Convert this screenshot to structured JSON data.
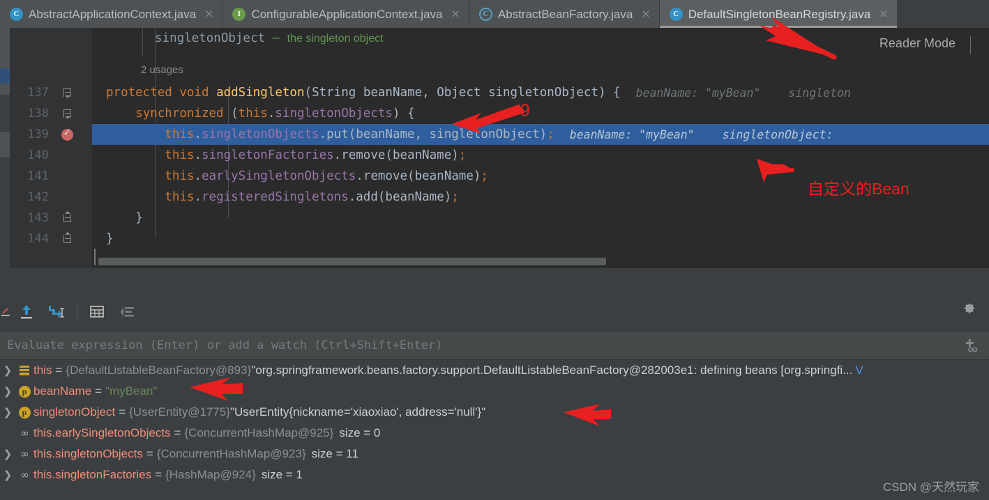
{
  "tabs": [
    {
      "label": "AbstractApplicationContext.java",
      "icon": "java-class-icon",
      "icon_kind": "cls",
      "active": false,
      "close": "×"
    },
    {
      "label": "ConfigurableApplicationContext.java",
      "icon": "java-interface-icon",
      "icon_kind": "iface",
      "active": false,
      "close": "×"
    },
    {
      "label": "AbstractBeanFactory.java",
      "icon": "java-class-icon",
      "icon_kind": "cls-ring",
      "active": false,
      "close": "×"
    },
    {
      "label": "DefaultSingletonBeanRegistry.java",
      "icon": "java-class-icon",
      "icon_kind": "cls",
      "active": true,
      "close": "×"
    }
  ],
  "editor": {
    "reader_mode_label": "Reader Mode",
    "usages_label": "2 usages",
    "javadoc": {
      "param": "singletonObject",
      "dash": " – ",
      "text": "the singleton object"
    },
    "lines": [
      {
        "number": "137",
        "fold": "arrow",
        "breakpoint": false,
        "highlight": false,
        "tokens": [
          {
            "t": "protected",
            "c": "kw"
          },
          {
            "t": " ",
            "c": "plain"
          },
          {
            "t": "void",
            "c": "kw"
          },
          {
            "t": " ",
            "c": "plain"
          },
          {
            "t": "addSingleton",
            "c": "mth"
          },
          {
            "t": "(",
            "c": "punc"
          },
          {
            "t": "String",
            "c": "typ"
          },
          {
            "t": " beanName, ",
            "c": "plain"
          },
          {
            "t": "Object",
            "c": "typ"
          },
          {
            "t": " singletonObject",
            "c": "plain"
          },
          {
            "t": ") {",
            "c": "punc"
          }
        ],
        "hints": [
          {
            "label": "beanName:",
            "value": "\"myBean\""
          },
          {
            "label": "singleton",
            "value": ""
          }
        ]
      },
      {
        "number": "138",
        "fold": "arrow",
        "breakpoint": false,
        "highlight": false,
        "tokens": [
          {
            "t": "    ",
            "c": "plain"
          },
          {
            "t": "synchronized",
            "c": "kw"
          },
          {
            "t": " (",
            "c": "punc"
          },
          {
            "t": "this",
            "c": "kw"
          },
          {
            "t": ".",
            "c": "punc"
          },
          {
            "t": "singletonObjects",
            "c": "fld"
          },
          {
            "t": ") {",
            "c": "punc"
          }
        ],
        "hints": []
      },
      {
        "number": "139",
        "fold": "none",
        "breakpoint": true,
        "highlight": true,
        "tokens": [
          {
            "t": "        ",
            "c": "plain"
          },
          {
            "t": "this",
            "c": "kw"
          },
          {
            "t": ".",
            "c": "punc"
          },
          {
            "t": "singletonObjects",
            "c": "fld"
          },
          {
            "t": ".",
            "c": "punc"
          },
          {
            "t": "put",
            "c": "plain"
          },
          {
            "t": "(beanName, singletonObject)",
            "c": "punc"
          },
          {
            "t": ";",
            "c": "semi"
          }
        ],
        "hints": [
          {
            "label": "beanName:",
            "value": "\"myBean\""
          },
          {
            "label": "singletonObject:",
            "value": ""
          }
        ]
      },
      {
        "number": "140",
        "fold": "none",
        "breakpoint": false,
        "highlight": false,
        "tokens": [
          {
            "t": "        ",
            "c": "plain"
          },
          {
            "t": "this",
            "c": "kw"
          },
          {
            "t": ".",
            "c": "punc"
          },
          {
            "t": "singletonFactories",
            "c": "fld"
          },
          {
            "t": ".",
            "c": "punc"
          },
          {
            "t": "remove",
            "c": "plain"
          },
          {
            "t": "(beanName)",
            "c": "punc"
          },
          {
            "t": ";",
            "c": "semi"
          }
        ],
        "hints": []
      },
      {
        "number": "141",
        "fold": "none",
        "breakpoint": false,
        "highlight": false,
        "tokens": [
          {
            "t": "        ",
            "c": "plain"
          },
          {
            "t": "this",
            "c": "kw"
          },
          {
            "t": ".",
            "c": "punc"
          },
          {
            "t": "earlySingletonObjects",
            "c": "fld"
          },
          {
            "t": ".",
            "c": "punc"
          },
          {
            "t": "remove",
            "c": "plain"
          },
          {
            "t": "(beanName)",
            "c": "punc"
          },
          {
            "t": ";",
            "c": "semi"
          }
        ],
        "hints": []
      },
      {
        "number": "142",
        "fold": "none",
        "breakpoint": false,
        "highlight": false,
        "tokens": [
          {
            "t": "        ",
            "c": "plain"
          },
          {
            "t": "this",
            "c": "kw"
          },
          {
            "t": ".",
            "c": "punc"
          },
          {
            "t": "registeredSingletons",
            "c": "fld"
          },
          {
            "t": ".",
            "c": "punc"
          },
          {
            "t": "add",
            "c": "plain"
          },
          {
            "t": "(beanName)",
            "c": "punc"
          },
          {
            "t": ";",
            "c": "semi"
          }
        ],
        "hints": []
      },
      {
        "number": "143",
        "fold": "up",
        "breakpoint": false,
        "highlight": false,
        "tokens": [
          {
            "t": "    }",
            "c": "punc"
          }
        ],
        "hints": []
      },
      {
        "number": "144",
        "fold": "up",
        "breakpoint": false,
        "highlight": false,
        "tokens": [
          {
            "t": "}",
            "c": "punc"
          }
        ],
        "hints": []
      }
    ]
  },
  "debugger": {
    "toolbar_icons": [
      {
        "name": "step-out-icon",
        "glyph": "↑"
      },
      {
        "name": "force-step-into-icon",
        "glyph": "↘"
      },
      {
        "name": "table-view-icon",
        "glyph": "▦"
      },
      {
        "name": "sort-values-icon",
        "glyph": "≡"
      }
    ],
    "settings_icon": "gear-icon",
    "evaluate": {
      "placeholder": "Evaluate expression (Enter) or add a watch (Ctrl+Shift+Enter)",
      "value": "",
      "add_watch_icon": "add-watch-icon"
    },
    "variables": [
      {
        "expandable": true,
        "icon": "frame-icon",
        "name": "this",
        "ref": "{DefaultListableBeanFactory@893}",
        "value": "\"org.springframework.beans.factory.support.DefaultListableBeanFactory@282003e1: defining beans [org.springfi...",
        "value_style": "string",
        "link": "V",
        "size": ""
      },
      {
        "expandable": true,
        "icon": "parameter-icon",
        "name": "beanName",
        "ref": "",
        "value": "\"myBean\"",
        "value_style": "string-green",
        "link": "",
        "size": ""
      },
      {
        "expandable": true,
        "icon": "parameter-icon",
        "name": "singletonObject",
        "ref": "{UserEntity@1775}",
        "value": "\"UserEntity{nickname='xiaoxiao', address='null'}\"",
        "value_style": "string",
        "link": "",
        "size": ""
      },
      {
        "expandable": false,
        "icon": "watch-icon",
        "name": "this.earlySingletonObjects",
        "ref": "{ConcurrentHashMap@925}",
        "value": "",
        "value_style": "string",
        "link": "",
        "size": "size = 0"
      },
      {
        "expandable": true,
        "icon": "watch-icon",
        "name": "this.singletonObjects",
        "ref": "{ConcurrentHashMap@923}",
        "value": "",
        "value_style": "string",
        "link": "",
        "size": "size = 11"
      },
      {
        "expandable": true,
        "icon": "watch-icon",
        "name": "this.singletonFactories",
        "ref": "{HashMap@924}",
        "value": "",
        "value_style": "string",
        "link": "",
        "size": "size = 1"
      }
    ]
  },
  "annotations": {
    "color": "#e82020",
    "labels": [
      {
        "id": "callout-9",
        "text": "9"
      },
      {
        "id": "callout-custom-bean",
        "text": "自定义的Bean"
      }
    ],
    "arrows": [
      "arrow-to-active-tab",
      "arrow-to-line-139",
      "arrow-to-inline-hint",
      "arrow-to-beanname-value",
      "arrow-to-singletonobject-value"
    ]
  },
  "watermark": "CSDN @天然玩家"
}
